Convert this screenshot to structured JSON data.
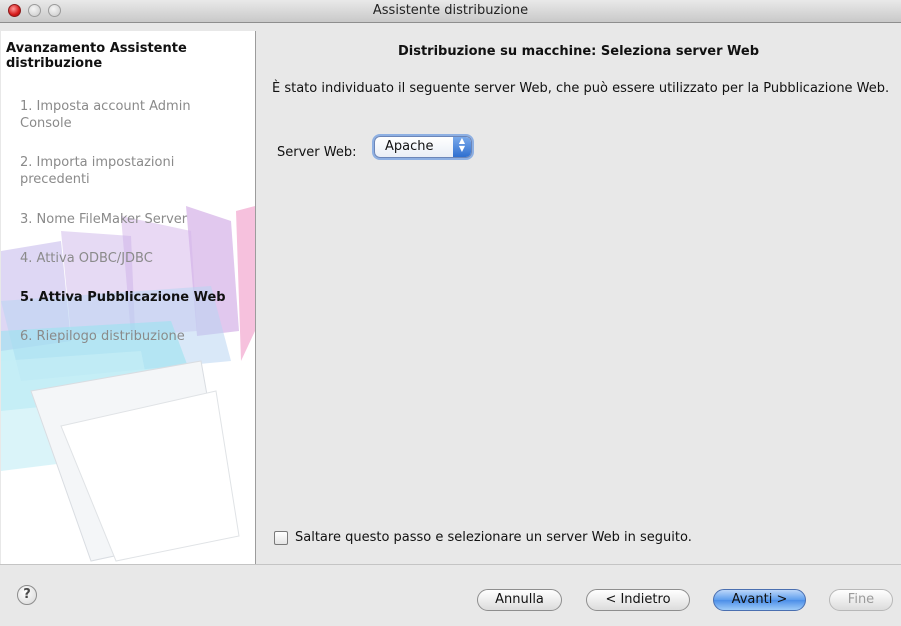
{
  "window": {
    "title": "Assistente distribuzione"
  },
  "sidebar": {
    "title": "Avanzamento Assistente distribuzione",
    "steps": [
      {
        "label": "1. Imposta account Admin Console"
      },
      {
        "label": "2. Importa impostazioni precedenti"
      },
      {
        "label": "3. Nome FileMaker Server"
      },
      {
        "label": "4. Attiva ODBC/JDBC"
      },
      {
        "label": "5. Attiva Pubblicazione Web"
      },
      {
        "label": "6. Riepilogo distribuzione"
      }
    ],
    "active_step": 5
  },
  "main": {
    "heading": "Distribuzione su macchine: Seleziona server Web",
    "description": "È stato individuato il seguente server Web, che può essere utilizzato per la Pubblicazione Web.",
    "server_label": "Server Web:",
    "server_value": "Apache",
    "skip_checkbox_label": "Saltare questo passo e selezionare un server Web in seguito.",
    "skip_checked": false
  },
  "footer": {
    "help": "?",
    "cancel": "Annulla",
    "back": "< Indietro",
    "next": "Avanti >",
    "finish": "Fine"
  }
}
